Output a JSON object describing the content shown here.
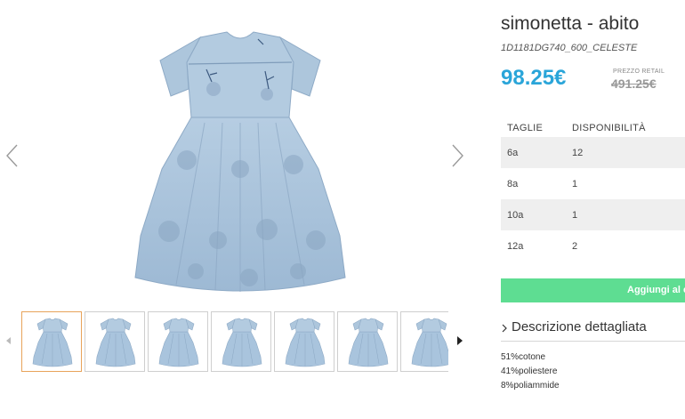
{
  "product": {
    "title": "simonetta - abito",
    "sku": "1D1181DG740_600_CELESTE",
    "price": "98.25€",
    "retail_label": "PREZZO RETAIL",
    "retail_price": "491.25€"
  },
  "gallery": {
    "main_icon": "dress-image",
    "prev_icon": "chevron-left-icon",
    "next_icon": "chevron-right-icon",
    "thumbnail_count": 7,
    "active_thumbnail": 1
  },
  "sizes_table": {
    "headers": [
      "TAGLIE",
      "DISPONIBILITÀ"
    ],
    "rows": [
      {
        "size": "6a",
        "qty": "12"
      },
      {
        "size": "8a",
        "qty": "1"
      },
      {
        "size": "10a",
        "qty": "1"
      },
      {
        "size": "12a",
        "qty": "2"
      }
    ]
  },
  "cart": {
    "add_label": "Aggiungi al c"
  },
  "description": {
    "toggle_label": "Descrizione dettagliata",
    "composition": [
      "51%cotone",
      "41%poliestere",
      "8%poliammide"
    ]
  },
  "colors": {
    "accent_price": "#2aa5d9",
    "add_button": "#5edd92",
    "dress": "#a9c4dd",
    "active_thumb_border": "#e8a35a"
  }
}
